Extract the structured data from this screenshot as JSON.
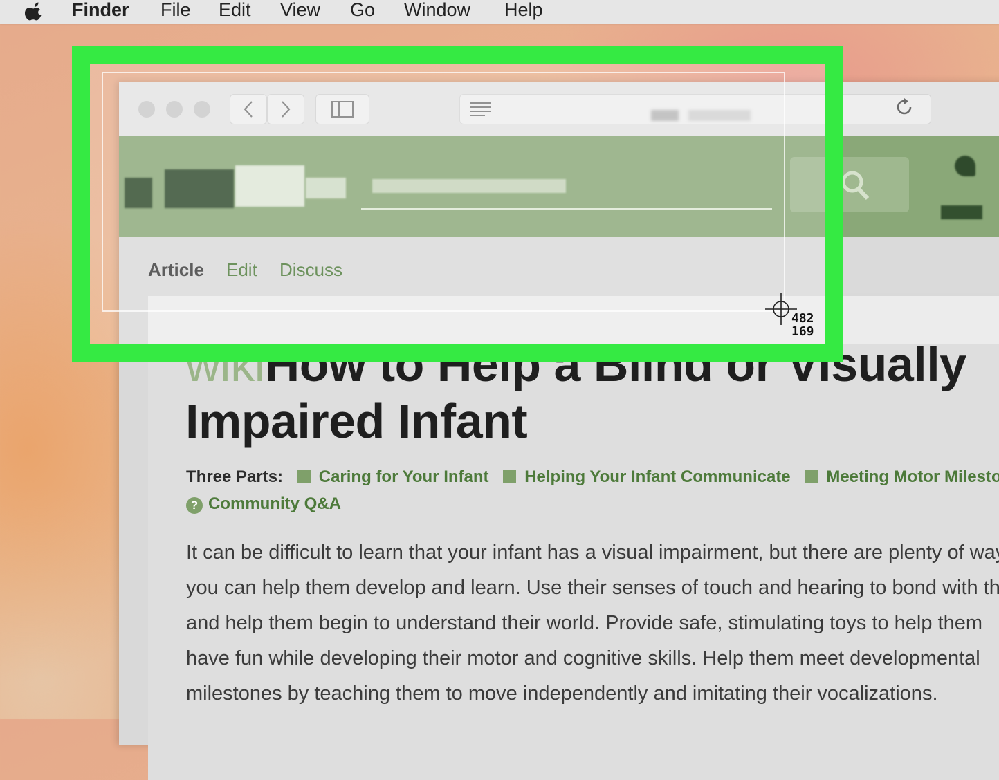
{
  "menubar": {
    "app_name": "Finder",
    "items": [
      "File",
      "Edit",
      "View",
      "Go",
      "Window",
      "Help"
    ]
  },
  "browser": {
    "tabs": {
      "article": "Article",
      "edit": "Edit",
      "discuss": "Discuss"
    }
  },
  "article": {
    "title_prefix": "wiki",
    "title": "How to Help a Blind or Visually Impaired Infant",
    "parts_label": "Three Parts:",
    "parts": [
      "Caring for Your Infant",
      "Helping Your Infant Communicate",
      "Meeting Motor Milestones"
    ],
    "qa_link": "Community Q&A",
    "intro_lines": [
      "It can be difficult to learn that your infant has a visual impairment, but there are plenty of ways",
      "you can help them develop and learn. Use their senses of touch and hearing to bond with them",
      "and help them begin to understand their world. Provide safe, stimulating toys to help them",
      "have fun while developing their motor and cognitive skills. Help them meet developmental",
      "milestones by teaching them to move independently and imitating their vocalizations."
    ]
  },
  "screenshot_tool": {
    "coord_x": "482",
    "coord_y": "169"
  },
  "colors": {
    "highlight": "#35ea43",
    "header_green": "#8aa878",
    "link_green": "#4d7a3a"
  },
  "icons": [
    "apple-icon",
    "back-icon",
    "forward-icon",
    "sidebar-icon",
    "reader-icon",
    "reload-icon",
    "search-icon",
    "crosshair-icon",
    "question-icon"
  ]
}
